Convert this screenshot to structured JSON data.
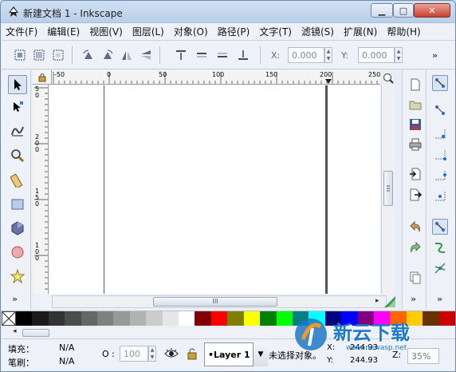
{
  "window": {
    "title": "新建文档 1 - Inkscape",
    "min_label": "▁",
    "max_label": "□",
    "close_label": "✕"
  },
  "menu": [
    "文件(F)",
    "编辑(E)",
    "视图(V)",
    "图层(L)",
    "对象(O)",
    "路径(P)",
    "文字(T)",
    "滤镜(S)",
    "扩展(N)",
    "帮助(H)"
  ],
  "toolbar": {
    "x_label": "X:",
    "x_value": "0.000",
    "y_label": "Y:",
    "y_value": "0.000",
    "more": "»"
  },
  "ruler": {
    "h_ticks": [
      "-50",
      "0",
      "50",
      "100",
      "150",
      "200",
      "250"
    ],
    "v_ticks": [
      "5\n0",
      "2\n0\n0",
      "1\n5\n0",
      "1\n0\n0"
    ]
  },
  "left_more": "»",
  "scroll_thumb": "III",
  "palette": [
    "#000000",
    "#1a1a1a",
    "#333333",
    "#4d4d4d",
    "#666666",
    "#808080",
    "#999999",
    "#b3b3b3",
    "#cccccc",
    "#e6e6e6",
    "#ffffff",
    "#800000",
    "#ff0000",
    "#808000",
    "#ffff00",
    "#008000",
    "#00ff00",
    "#008080",
    "#00ffff",
    "#000080",
    "#0000ff",
    "#800080",
    "#ff00ff",
    "#ff6600",
    "#ffcc00",
    "#663300",
    "#cc0000"
  ],
  "status": {
    "fill_label": "填充：",
    "fill_value": "N/A",
    "stroke_label": "笔刷：",
    "stroke_value": "N/A",
    "opacity_label": "O :",
    "opacity_value": "100",
    "layer_value": "•Layer 1",
    "message": "未选择对象。",
    "x_label": "X:",
    "x_value": "244.93",
    "y_label": "Y:",
    "y_value": "244.93",
    "zoom_label": "Z:",
    "zoom_value": "35%"
  },
  "watermark": {
    "brand": "新云下载",
    "url": "www.newasp.net"
  },
  "colors": {
    "accent": "#2a6fbf",
    "brand_orange": "#f29a1f",
    "brand_blue": "#1d78c8"
  }
}
